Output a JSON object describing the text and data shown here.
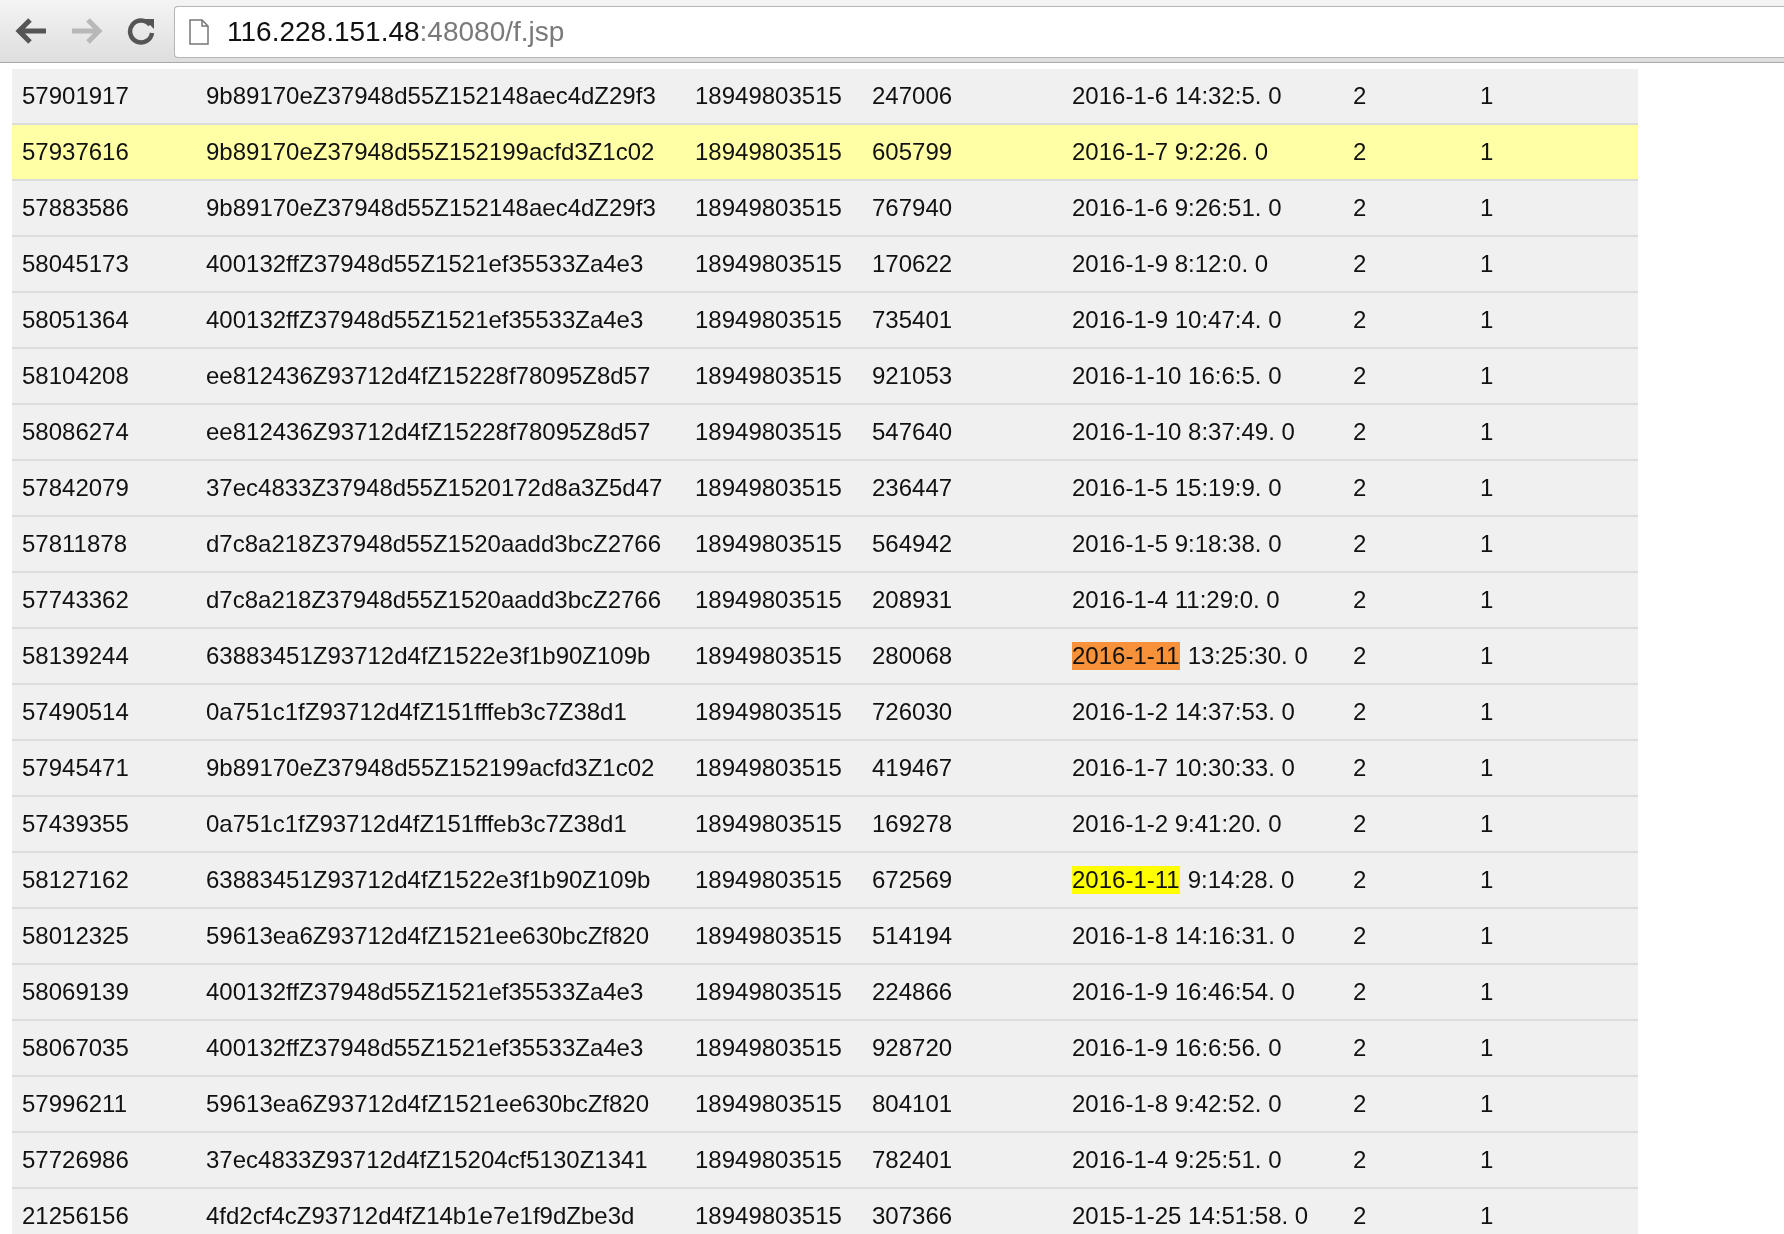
{
  "browser": {
    "url_host": "116.228.151.48",
    "url_path": ":48080/f.jsp"
  },
  "rows": [
    {
      "id": "57901917",
      "hash": "9b89170eZ37948d55Z152148aec4dZ29f3",
      "phone": "18949803515",
      "code": "247006",
      "time": "2016-1-6 14:32:5. 0",
      "col_6": "2",
      "col_7": "1",
      "highlighted": false
    },
    {
      "id": "57937616",
      "hash": "9b89170eZ37948d55Z152199acfd3Z1c02",
      "phone": "18949803515",
      "code": "605799",
      "time": "2016-1-7 9:2:26. 0",
      "col_6": "2",
      "col_7": "1",
      "highlighted": true
    },
    {
      "id": "57883586",
      "hash": "9b89170eZ37948d55Z152148aec4dZ29f3",
      "phone": "18949803515",
      "code": "767940",
      "time": "2016-1-6 9:26:51. 0",
      "col_6": "2",
      "col_7": "1",
      "highlighted": false
    },
    {
      "id": "58045173",
      "hash": "400132ffZ37948d55Z1521ef35533Za4e3",
      "phone": "18949803515",
      "code": "170622",
      "time": "2016-1-9 8:12:0. 0",
      "col_6": "2",
      "col_7": "1",
      "highlighted": false
    },
    {
      "id": "58051364",
      "hash": "400132ffZ37948d55Z1521ef35533Za4e3",
      "phone": "18949803515",
      "code": "735401",
      "time": "2016-1-9 10:47:4. 0",
      "col_6": "2",
      "col_7": "1",
      "highlighted": false
    },
    {
      "id": "58104208",
      "hash": "ee812436Z93712d4fZ15228f78095Z8d57",
      "phone": "18949803515",
      "code": "921053",
      "time": "2016-1-10 16:6:5. 0",
      "col_6": "2",
      "col_7": "1",
      "highlighted": false
    },
    {
      "id": "58086274",
      "hash": "ee812436Z93712d4fZ15228f78095Z8d57",
      "phone": "18949803515",
      "code": "547640",
      "time": "2016-1-10 8:37:49. 0",
      "col_6": "2",
      "col_7": "1",
      "highlighted": false
    },
    {
      "id": "57842079",
      "hash": "37ec4833Z37948d55Z1520172d8a3Z5d47",
      "phone": "18949803515",
      "code": "236447",
      "time": "2016-1-5 15:19:9. 0",
      "col_6": "2",
      "col_7": "1",
      "highlighted": false
    },
    {
      "id": "57811878",
      "hash": "d7c8a218Z37948d55Z1520aadd3bcZ2766",
      "phone": "18949803515",
      "code": "564942",
      "time": "2016-1-5 9:18:38. 0",
      "col_6": "2",
      "col_7": "1",
      "highlighted": false
    },
    {
      "id": "57743362",
      "hash": "d7c8a218Z37948d55Z1520aadd3bcZ2766",
      "phone": "18949803515",
      "code": "208931",
      "time": "2016-1-4 11:29:0. 0",
      "col_6": "2",
      "col_7": "1",
      "highlighted": false
    },
    {
      "id": "58139244",
      "hash": "63883451Z93712d4fZ1522e3f1b90Z109b",
      "phone": "18949803515",
      "code": "280068",
      "date_mark": {
        "text": "2016-1-11",
        "color": "#f7923a"
      },
      "time": "13:25:30. 0",
      "col_6": "2",
      "col_7": "1",
      "highlighted": false
    },
    {
      "id": "57490514",
      "hash": "0a751c1fZ93712d4fZ151fffeb3c7Z38d1",
      "phone": "18949803515",
      "code": "726030",
      "time": "2016-1-2 14:37:53. 0",
      "col_6": "2",
      "col_7": "1",
      "highlighted": false
    },
    {
      "id": "57945471",
      "hash": "9b89170eZ37948d55Z152199acfd3Z1c02",
      "phone": "18949803515",
      "code": "419467",
      "time": "2016-1-7 10:30:33. 0",
      "col_6": "2",
      "col_7": "1",
      "highlighted": false
    },
    {
      "id": "57439355",
      "hash": "0a751c1fZ93712d4fZ151fffeb3c7Z38d1",
      "phone": "18949803515",
      "code": "169278",
      "time": "2016-1-2 9:41:20. 0",
      "col_6": "2",
      "col_7": "1",
      "highlighted": false
    },
    {
      "id": "58127162",
      "hash": "63883451Z93712d4fZ1522e3f1b90Z109b",
      "phone": "18949803515",
      "code": "672569",
      "date_mark": {
        "text": "2016-1-11",
        "color": "#ffff00"
      },
      "time": "9:14:28. 0",
      "col_6": "2",
      "col_7": "1",
      "highlighted": false
    },
    {
      "id": "58012325",
      "hash": "59613ea6Z93712d4fZ1521ee630bcZf820",
      "phone": "18949803515",
      "code": "514194",
      "time": "2016-1-8 14:16:31. 0",
      "col_6": "2",
      "col_7": "1",
      "highlighted": false
    },
    {
      "id": "58069139",
      "hash": "400132ffZ37948d55Z1521ef35533Za4e3",
      "phone": "18949803515",
      "code": "224866",
      "time": "2016-1-9 16:46:54. 0",
      "col_6": "2",
      "col_7": "1",
      "highlighted": false
    },
    {
      "id": "58067035",
      "hash": "400132ffZ37948d55Z1521ef35533Za4e3",
      "phone": "18949803515",
      "code": "928720",
      "time": "2016-1-9 16:6:56. 0",
      "col_6": "2",
      "col_7": "1",
      "highlighted": false
    },
    {
      "id": "57996211",
      "hash": "59613ea6Z93712d4fZ1521ee630bcZf820",
      "phone": "18949803515",
      "code": "804101",
      "time": "2016-1-8 9:42:52. 0",
      "col_6": "2",
      "col_7": "1",
      "highlighted": false
    },
    {
      "id": "57726986",
      "hash": "37ec4833Z93712d4fZ15204cf5130Z1341",
      "phone": "18949803515",
      "code": "782401",
      "time": "2016-1-4 9:25:51. 0",
      "col_6": "2",
      "col_7": "1",
      "highlighted": false
    },
    {
      "id": "21256156",
      "hash": "4fd2cf4cZ93712d4fZ14b1e7e1f9dZbe3d",
      "phone": "18949803515",
      "code": "307366",
      "time": "2015-1-25 14:51:58. 0",
      "col_6": "2",
      "col_7": "1",
      "highlighted": false
    }
  ]
}
